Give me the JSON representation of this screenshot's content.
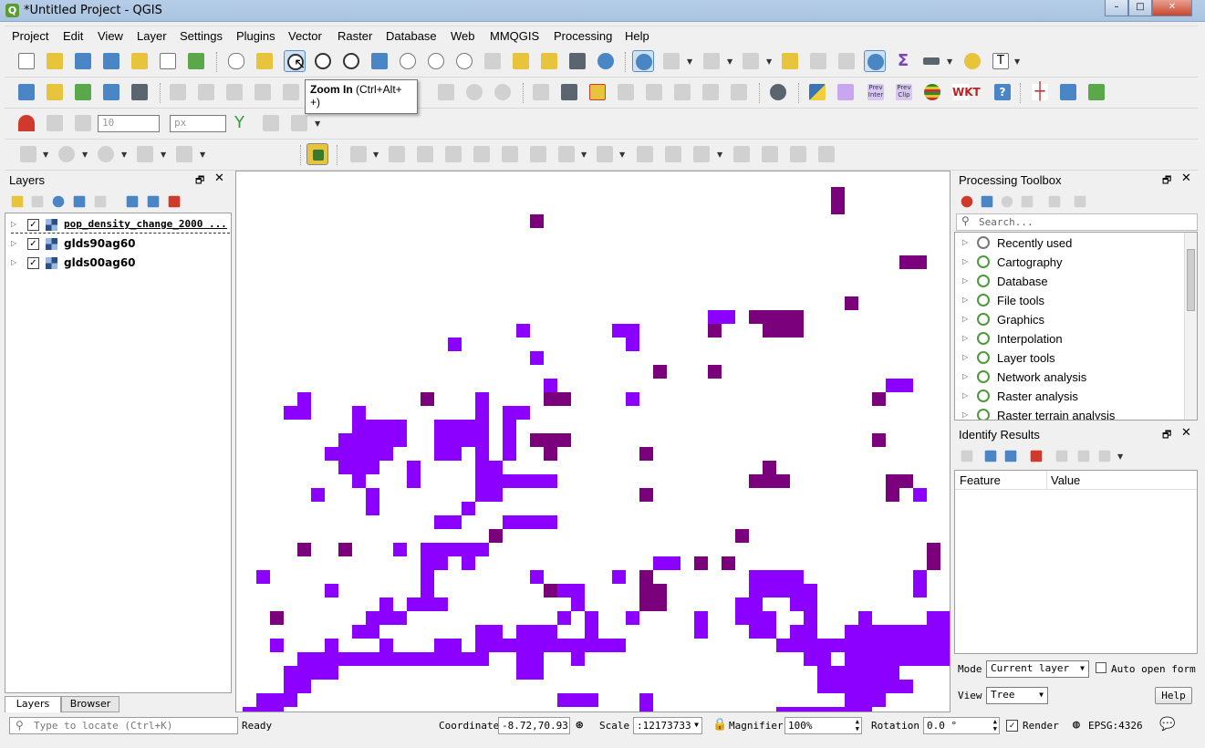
{
  "window": {
    "title": "*Untitled Project - QGIS",
    "app_icon": "qgis-icon"
  },
  "menu": [
    "Project",
    "Edit",
    "View",
    "Layer",
    "Settings",
    "Plugins",
    "Vector",
    "Raster",
    "Database",
    "Web",
    "MMQGIS",
    "Processing",
    "Help"
  ],
  "tooltip": {
    "title": "Zoom In",
    "shortcut": "(Ctrl+Alt+ +)"
  },
  "digitize": {
    "size_value": "10",
    "unit": "px"
  },
  "plugin_buttons": {
    "prev_inter": "Prev Inter",
    "prev_clip": "Prev Clip"
  },
  "layers_panel": {
    "title": "Layers",
    "layers": [
      {
        "name": "pop_density_change_2000 ...",
        "checked": true
      },
      {
        "name": "glds90ag60",
        "checked": true
      },
      {
        "name": "glds00ag60",
        "checked": true
      }
    ],
    "tabs": [
      "Layers",
      "Browser"
    ]
  },
  "processing": {
    "title": "Processing Toolbox",
    "search_placeholder": "Search...",
    "items": [
      "Recently used",
      "Cartography",
      "Database",
      "File tools",
      "Graphics",
      "Interpolation",
      "Layer tools",
      "Network analysis",
      "Raster analysis",
      "Raster terrain analysis"
    ]
  },
  "identify": {
    "title": "Identify Results",
    "columns": [
      "Feature",
      "Value"
    ],
    "mode_label": "Mode",
    "mode_value": "Current layer",
    "auto_open_label": "Auto open form",
    "view_label": "View",
    "view_value": "Tree",
    "help_label": "Help"
  },
  "status": {
    "locate_placeholder": "Type to locate (Ctrl+K)",
    "message": "Ready",
    "coordinate_label": "Coordinate",
    "coordinate_value": "-8.72,70.93",
    "scale_label": "Scale",
    "scale_value": ":12173733",
    "magnifier_label": "Magnifier",
    "magnifier_value": "100%",
    "rotation_label": "Rotation",
    "rotation_value": "0.0 °",
    "render_label": "Render",
    "crs": "EPSG:4326"
  },
  "colors": {
    "bright_purple": "#8b00ff",
    "dark_purple": "#7b007b"
  }
}
